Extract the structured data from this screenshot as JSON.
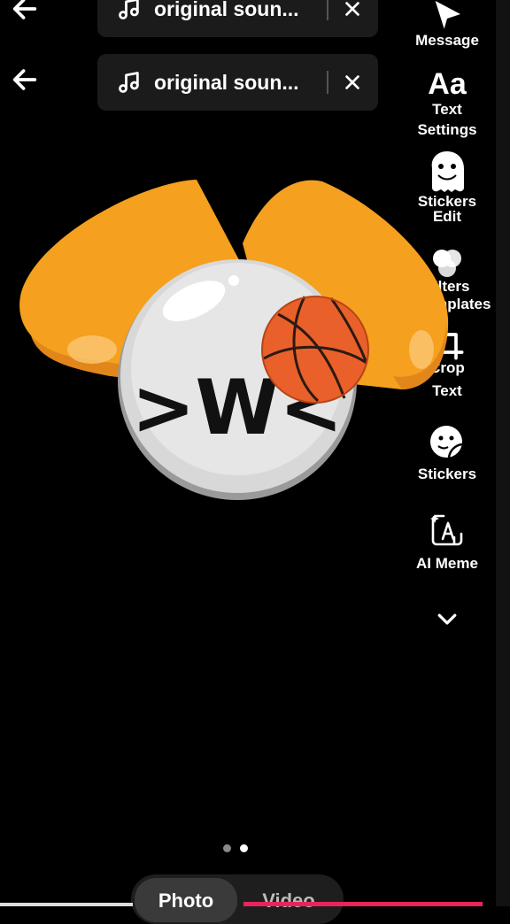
{
  "header": {
    "sound_label": "original soun...",
    "sound_label_2": "original soun..."
  },
  "sidebar": {
    "items": [
      {
        "label": "Message",
        "icon": "send-icon"
      },
      {
        "label": "Text",
        "icon": "text-aa-icon"
      },
      {
        "label": "Settings",
        "icon": "settings-icon"
      },
      {
        "label": "Stickers",
        "icon": "sticker-icon"
      },
      {
        "label": "Edit",
        "icon": "edit-icon"
      },
      {
        "label": "Filters",
        "icon": "filters-icon"
      },
      {
        "label": "Templates",
        "icon": "templates-icon"
      },
      {
        "label": "Crop",
        "icon": "crop-icon"
      },
      {
        "label": "Text",
        "icon": "text-aa-icon"
      },
      {
        "label": "Stickers",
        "icon": "sticker-icon"
      },
      {
        "label": "AI Meme",
        "icon": "ai-meme-icon"
      }
    ]
  },
  "canvas": {
    "face_text": ">W<"
  },
  "mode_toggle": {
    "photo": "Photo",
    "video": "Video",
    "selected": "Photo"
  },
  "colors": {
    "heart": "#F5A01E",
    "heart_shadow": "#E0861A",
    "ball": "#E9602A",
    "accent_bar": "#E8255A"
  }
}
